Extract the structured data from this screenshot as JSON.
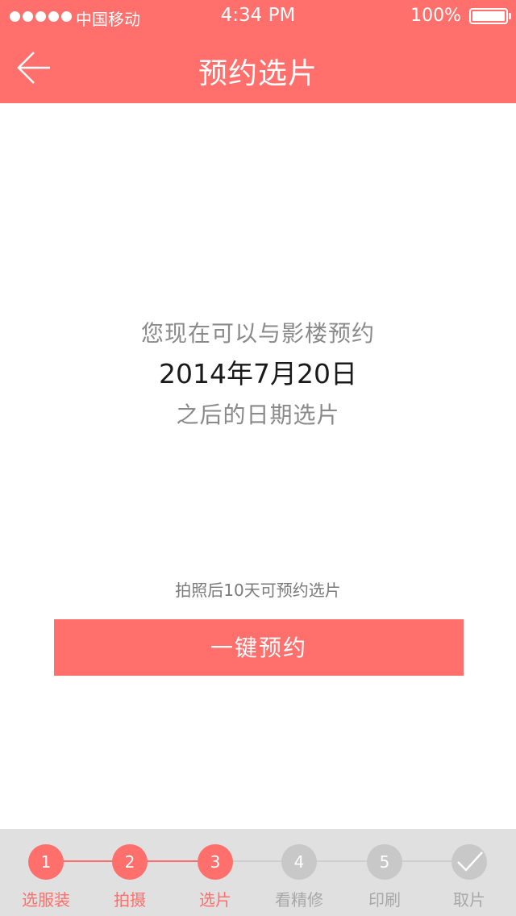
{
  "status_bar": {
    "carrier": "中国移动",
    "time": "4:34 PM",
    "battery": "100%"
  },
  "nav": {
    "back_icon": "arrow-left-icon",
    "title": "预约选片"
  },
  "message": {
    "line1": "您现在可以与影楼预约",
    "date": "2014年7月20日",
    "line3": "之后的日期选片"
  },
  "hint": "拍照后10天可预约选片",
  "book_button": "一键预约",
  "progress": {
    "steps": [
      {
        "number": "1",
        "label": "选服装",
        "state": "done"
      },
      {
        "number": "2",
        "label": "拍摄",
        "state": "done"
      },
      {
        "number": "3",
        "label": "选片",
        "state": "current"
      },
      {
        "number": "4",
        "label": "看精修",
        "state": "pending"
      },
      {
        "number": "5",
        "label": "印刷",
        "state": "pending"
      },
      {
        "number": "",
        "label": "取片",
        "state": "pending",
        "icon": "checkmark-icon"
      }
    ]
  },
  "colors": {
    "accent": "#ff6f6c",
    "inactive": "#c8c8c8",
    "footer_bg": "#e0e0e0"
  }
}
